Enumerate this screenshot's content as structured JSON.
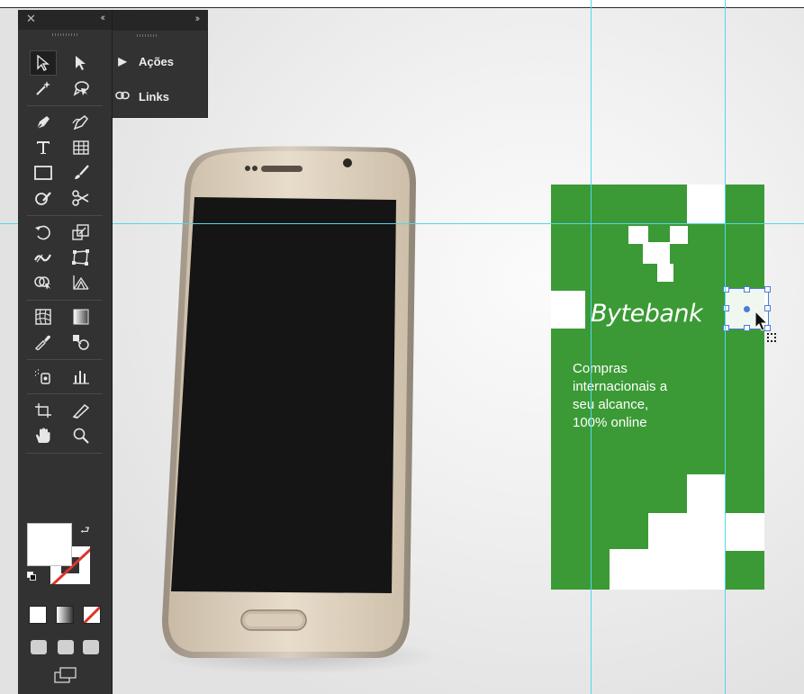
{
  "panels": {
    "secondary": {
      "items": [
        {
          "label": "Ações",
          "icon": "play-triangle-icon"
        },
        {
          "label": "Links",
          "icon": "link-icon"
        }
      ]
    }
  },
  "tools_panel": {
    "tools": [
      "selection-tool",
      "direct-selection-tool",
      "magic-wand-tool",
      "lasso-tool",
      "pen-tool",
      "curvature-tool",
      "type-tool",
      "table-grid-tool",
      "rectangle-tool",
      "paintbrush-tool",
      "shaper-tool",
      "scissors-tool",
      "rotate-tool",
      "scale-tool",
      "width-tool",
      "free-transform-tool",
      "shape-builder-tool",
      "perspective-grid-tool",
      "mesh-tool",
      "gradient-tool",
      "eyedropper-tool",
      "blend-tool",
      "symbol-sprayer-tool",
      "column-graph-tool",
      "artboard-tool",
      "slice-tool",
      "hand-tool",
      "zoom-tool"
    ],
    "fill_color": "#ffffff",
    "stroke": "none"
  },
  "artboard": {
    "background_color": "#3b9a35",
    "brand": "Bytebank",
    "tagline_lines": [
      "Compras",
      "internacionais a",
      "seu alcance,",
      "100% online"
    ]
  },
  "colors": {
    "guide": "#4fd8ea",
    "selection": "#4b7bd9",
    "panel_bg": "#323232"
  }
}
